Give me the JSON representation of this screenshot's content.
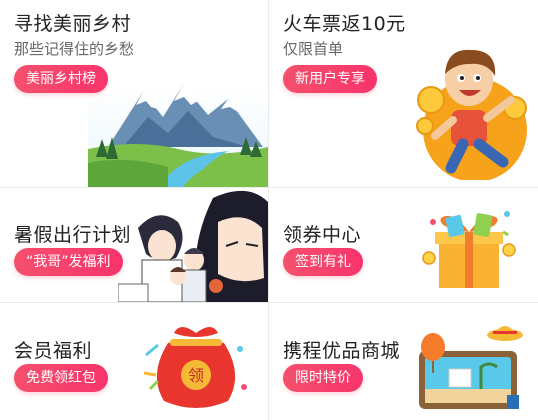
{
  "cards": [
    {
      "title": "寻找美丽乡村",
      "subtitle": "那些记得住的乡愁",
      "button": "美丽乡村榜",
      "icon": "mountain-landscape-icon"
    },
    {
      "title": "火车票返10元",
      "subtitle": "仅限首单",
      "button": "新用户专享",
      "icon": "running-man-coins-icon"
    },
    {
      "title": "暑假出行计划",
      "button": "“我哥”发福利",
      "icon": "anime-characters-illustration"
    },
    {
      "title": "领券中心",
      "button": "签到有礼",
      "icon": "gift-box-icon"
    },
    {
      "title": "会员福利",
      "button": "免费领红包",
      "icon": "red-lucky-bag-icon",
      "badge": "领"
    },
    {
      "title": "携程优品商城",
      "button": "限时特价",
      "icon": "travel-suitcase-icon"
    }
  ],
  "colors": {
    "accent": "#f5506d",
    "title": "#222222",
    "subtitle": "#666666",
    "divider": "#ececec"
  }
}
